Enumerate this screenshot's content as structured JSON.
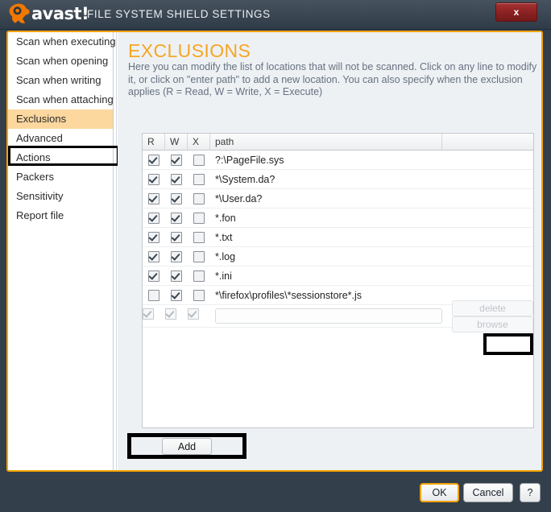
{
  "titlebar": {
    "logo_icon": "avast-logo-icon",
    "logo_word": "avast!",
    "app_title": "FILE SYSTEM SHIELD SETTINGS",
    "close_label": "x"
  },
  "sidebar": {
    "items": [
      {
        "label": "Scan when executing",
        "selected": false
      },
      {
        "label": "Scan when opening",
        "selected": false
      },
      {
        "label": "Scan when writing",
        "selected": false
      },
      {
        "label": "Scan when attaching",
        "selected": false
      },
      {
        "label": "Exclusions",
        "selected": true
      },
      {
        "label": "Advanced",
        "selected": false
      },
      {
        "label": "Actions",
        "selected": false
      },
      {
        "label": "Packers",
        "selected": false
      },
      {
        "label": "Sensitivity",
        "selected": false
      },
      {
        "label": "Report file",
        "selected": false
      }
    ]
  },
  "content": {
    "title": "EXCLUSIONS",
    "description": "Here you can modify the list of locations that will not be scanned. Click on any line to modify it, or click on \"enter path\" to add a new location.\nYou can also specify when the exclusion applies (R = Read, W = Write, X = Execute)",
    "table": {
      "columns": [
        "R",
        "W",
        "X",
        "path",
        ""
      ],
      "rows": [
        {
          "r": true,
          "w": true,
          "x": false,
          "path": "?:\\PageFile.sys"
        },
        {
          "r": true,
          "w": true,
          "x": false,
          "path": "*\\System.da?"
        },
        {
          "r": true,
          "w": true,
          "x": false,
          "path": "*\\User.da?"
        },
        {
          "r": true,
          "w": true,
          "x": false,
          "path": "*.fon"
        },
        {
          "r": true,
          "w": true,
          "x": false,
          "path": "*.txt"
        },
        {
          "r": true,
          "w": true,
          "x": false,
          "path": "*.log"
        },
        {
          "r": true,
          "w": true,
          "x": false,
          "path": "*.ini"
        },
        {
          "r": false,
          "w": true,
          "x": false,
          "path": "*\\firefox\\profiles\\*sessionstore*.js"
        }
      ],
      "entry_row": {
        "r": true,
        "w": true,
        "x": true,
        "path_value": "",
        "path_placeholder": "",
        "delete_label": "delete",
        "browse_label": "browse"
      }
    },
    "add_label": "Add"
  },
  "footer": {
    "ok_label": "OK",
    "cancel_label": "Cancel",
    "help_label": "?"
  },
  "colors": {
    "accent": "#f5a300",
    "title_orange": "#f5a623",
    "window_bg": "#333f4a",
    "selection": "#fcd79e",
    "close_red": "#8c2222",
    "annotation": "#000000"
  }
}
